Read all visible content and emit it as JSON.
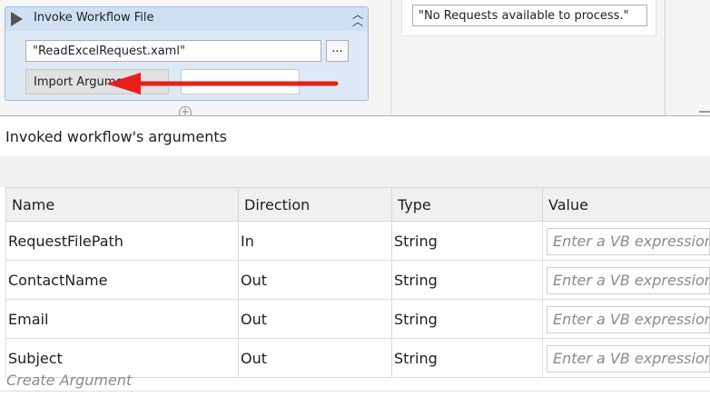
{
  "activity": {
    "title": "Invoke Workflow File",
    "file_value": "\"ReadExcelRequest.xaml\"",
    "browse_label": "...",
    "import_label": "Import Arguments",
    "collapse_icon": "double-chevron-up-icon",
    "play_icon": "play-triangle-icon"
  },
  "right_panel": {
    "message_value": "\"No Requests available to process.\""
  },
  "dialog": {
    "title": "Invoked workflow's arguments",
    "columns": [
      "Name",
      "Direction",
      "Type",
      "Value"
    ],
    "rows": [
      {
        "name": "RequestFilePath",
        "direction": "In",
        "type": "String",
        "value_placeholder": "Enter a VB expression"
      },
      {
        "name": "ContactName",
        "direction": "Out",
        "type": "String",
        "value_placeholder": "Enter a VB expression"
      },
      {
        "name": "Email",
        "direction": "Out",
        "type": "String",
        "value_placeholder": "Enter a VB expression"
      },
      {
        "name": "Subject",
        "direction": "Out",
        "type": "String",
        "value_placeholder": "Enter a VB expression"
      }
    ],
    "create_argument_label": "Create Argument"
  },
  "colors": {
    "annotation_arrow": "#e8201c",
    "activity_background": "#dde9f6",
    "activity_border": "#9ebbe0"
  }
}
